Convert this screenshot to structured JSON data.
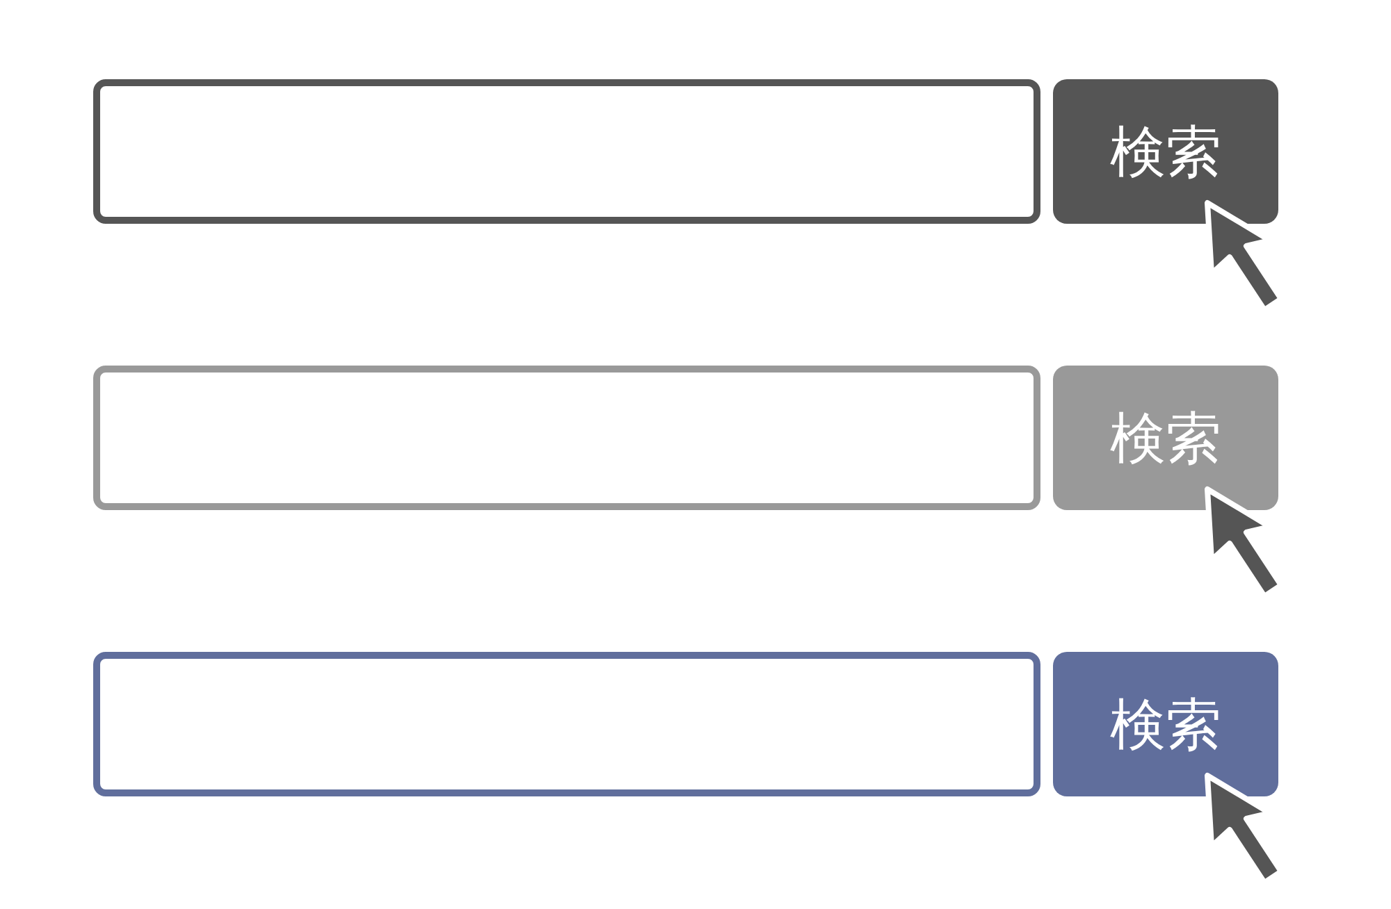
{
  "search_bars": [
    {
      "color": "#555555",
      "button_label": "検索"
    },
    {
      "color": "#999999",
      "button_label": "検索"
    },
    {
      "color": "#606e9c",
      "button_label": "検索"
    }
  ]
}
